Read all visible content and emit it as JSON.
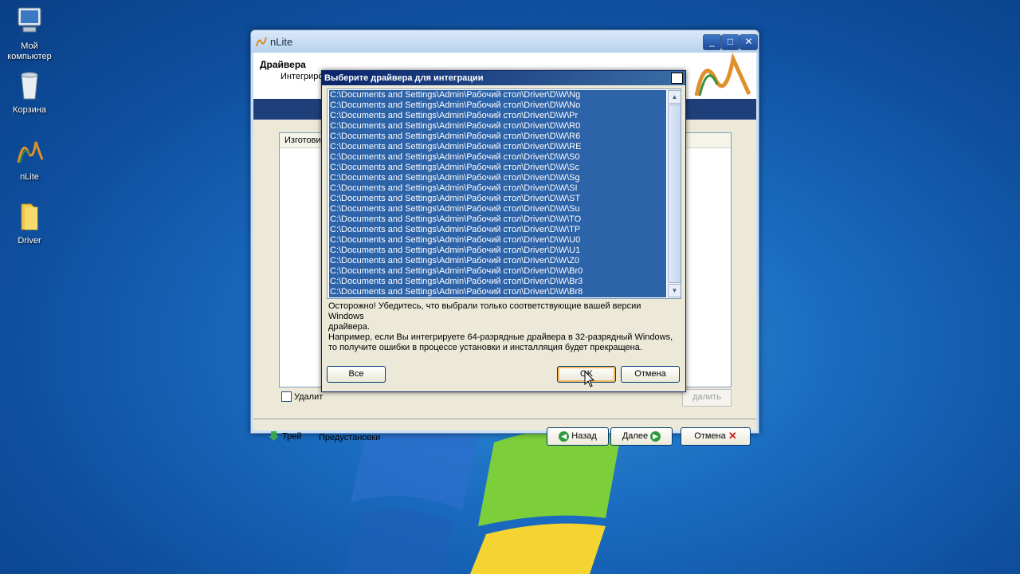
{
  "desktop": {
    "icons": [
      {
        "label": "Мой компьютер",
        "icon": "my-computer-icon"
      },
      {
        "label": "Корзина",
        "icon": "recycle-bin-icon"
      },
      {
        "label": "nLite",
        "icon": "nlite-shortcut-icon"
      },
      {
        "label": "Driver",
        "icon": "folder-icon"
      }
    ]
  },
  "main_window": {
    "title": "nLite",
    "header_title": "Драйвера",
    "header_subtitle": "Интегриро",
    "list_column": "Изготови",
    "checkbox_label": "Удалит",
    "bg_delete_label": "далить",
    "tray_label": "Трей",
    "presets_label": "Предустановки",
    "back_label": "Назад",
    "next_label": "Далее",
    "cancel_label": "Отмена",
    "colors": {
      "title_bar": "#c9dff4",
      "header_band": "#1f3f7a",
      "body": "#ece9d8"
    }
  },
  "dialog": {
    "title": "Выберите драйвера для интеграции",
    "items": [
      "C:\\Documents and Settings\\Admin\\Рабочий стол\\Driver\\D\\W\\Ng",
      "C:\\Documents and Settings\\Admin\\Рабочий стол\\Driver\\D\\W\\No",
      "C:\\Documents and Settings\\Admin\\Рабочий стол\\Driver\\D\\W\\Pr",
      "C:\\Documents and Settings\\Admin\\Рабочий стол\\Driver\\D\\W\\R0",
      "C:\\Documents and Settings\\Admin\\Рабочий стол\\Driver\\D\\W\\R6",
      "C:\\Documents and Settings\\Admin\\Рабочий стол\\Driver\\D\\W\\RE",
      "C:\\Documents and Settings\\Admin\\Рабочий стол\\Driver\\D\\W\\S0",
      "C:\\Documents and Settings\\Admin\\Рабочий стол\\Driver\\D\\W\\Sc",
      "C:\\Documents and Settings\\Admin\\Рабочий стол\\Driver\\D\\W\\Sg",
      "C:\\Documents and Settings\\Admin\\Рабочий стол\\Driver\\D\\W\\SI",
      "C:\\Documents and Settings\\Admin\\Рабочий стол\\Driver\\D\\W\\ST",
      "C:\\Documents and Settings\\Admin\\Рабочий стол\\Driver\\D\\W\\Su",
      "C:\\Documents and Settings\\Admin\\Рабочий стол\\Driver\\D\\W\\TO",
      "C:\\Documents and Settings\\Admin\\Рабочий стол\\Driver\\D\\W\\TP",
      "C:\\Documents and Settings\\Admin\\Рабочий стол\\Driver\\D\\W\\U0",
      "C:\\Documents and Settings\\Admin\\Рабочий стол\\Driver\\D\\W\\U1",
      "C:\\Documents and Settings\\Admin\\Рабочий стол\\Driver\\D\\W\\Z0",
      "C:\\Documents and Settings\\Admin\\Рабочий стол\\Driver\\D\\W\\Br0",
      "C:\\Documents and Settings\\Admin\\Рабочий стол\\Driver\\D\\W\\Br3",
      "C:\\Documents and Settings\\Admin\\Рабочий стол\\Driver\\D\\W\\Br8"
    ],
    "warning_line1": "Осторожно! Убедитесь, что выбрали только соответствующие вашей версии Windows",
    "warning_line2": "драйвера.",
    "warning_line3": "Например, если Вы интегрируете 64-разрядные драйвера в 32-разрядный Windows,",
    "warning_line4": "то получите ошибки в процессе установки и инсталляция будет прекращена.",
    "all_label": "Все",
    "ok_label": "OK",
    "cancel_label": "Отмена",
    "colors": {
      "selection": "#2d63a8",
      "title_bar": "#0a246a"
    }
  }
}
